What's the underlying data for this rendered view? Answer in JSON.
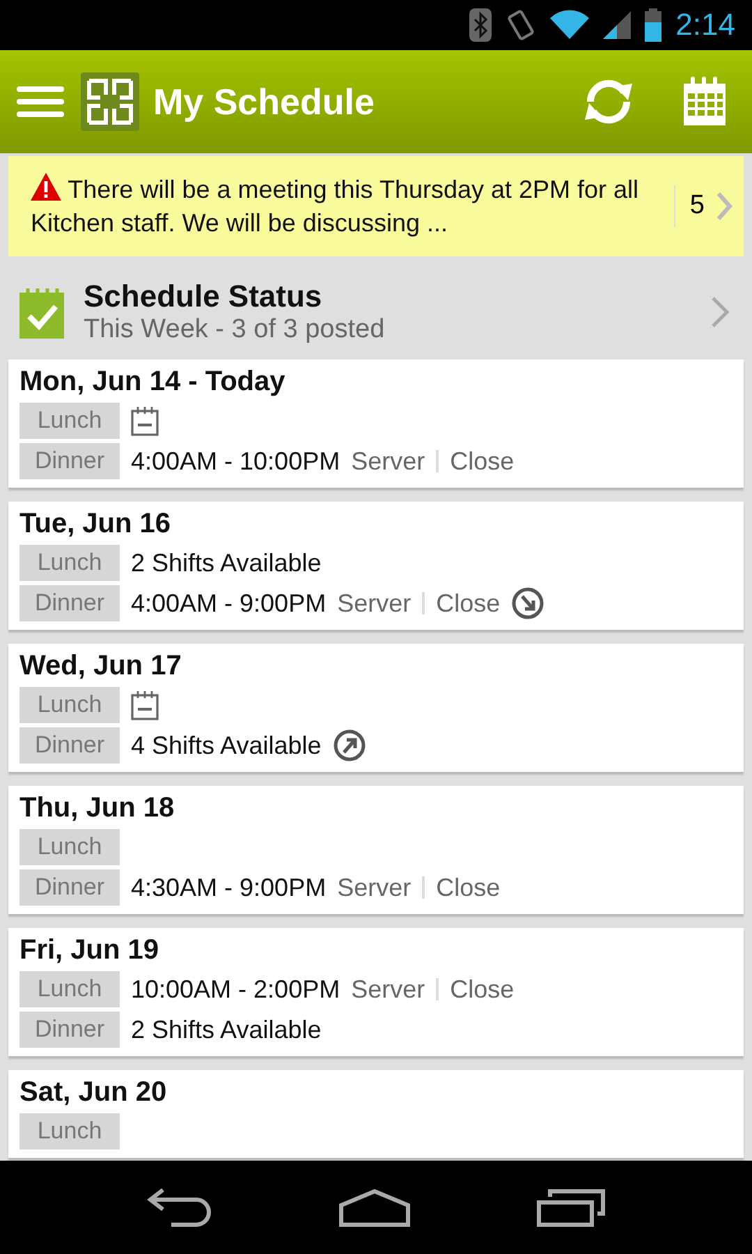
{
  "status_bar": {
    "time": "2:14"
  },
  "header": {
    "title": "My Schedule"
  },
  "announcement": {
    "text": "There will be a meeting this Thursday at 2PM for all Kitchen staff. We will be discussing ...",
    "count": "5"
  },
  "schedule_status": {
    "title": "Schedule Status",
    "subtitle": "This Week - 3 of 3 posted"
  },
  "days": [
    {
      "date": "Mon, Jun 14 - Today",
      "shifts": [
        {
          "meal": "Lunch",
          "kind": "off",
          "release_requested": false,
          "pickup_requested": false
        },
        {
          "meal": "Dinner",
          "kind": "time",
          "time": "4:00AM - 10:00PM",
          "role": "Server",
          "duty": "Close",
          "release_requested": false,
          "pickup_requested": false
        }
      ]
    },
    {
      "date": "Tue, Jun 16",
      "shifts": [
        {
          "meal": "Lunch",
          "kind": "open",
          "text": "2 Shifts Available",
          "release_requested": false,
          "pickup_requested": false
        },
        {
          "meal": "Dinner",
          "kind": "time",
          "time": "4:00AM - 9:00PM",
          "role": "Server",
          "duty": "Close",
          "release_requested": true,
          "pickup_requested": false
        }
      ]
    },
    {
      "date": "Wed, Jun 17",
      "shifts": [
        {
          "meal": "Lunch",
          "kind": "off",
          "release_requested": false,
          "pickup_requested": false
        },
        {
          "meal": "Dinner",
          "kind": "open",
          "text": "4 Shifts Available",
          "release_requested": false,
          "pickup_requested": true
        }
      ]
    },
    {
      "date": "Thu, Jun 18",
      "shifts": [
        {
          "meal": "Lunch",
          "kind": "blank",
          "release_requested": false,
          "pickup_requested": false
        },
        {
          "meal": "Dinner",
          "kind": "time",
          "time": "4:30AM - 9:00PM",
          "role": "Server",
          "duty": "Close",
          "release_requested": false,
          "pickup_requested": false
        }
      ]
    },
    {
      "date": "Fri, Jun 19",
      "shifts": [
        {
          "meal": "Lunch",
          "kind": "time",
          "time": "10:00AM - 2:00PM",
          "role": "Server",
          "duty": "Close",
          "release_requested": false,
          "pickup_requested": false
        },
        {
          "meal": "Dinner",
          "kind": "open",
          "text": "2 Shifts Available",
          "release_requested": false,
          "pickup_requested": false
        }
      ]
    },
    {
      "date": "Sat, Jun 20",
      "shifts": [
        {
          "meal": "Lunch",
          "kind": "blank",
          "release_requested": false,
          "pickup_requested": false
        }
      ]
    }
  ]
}
